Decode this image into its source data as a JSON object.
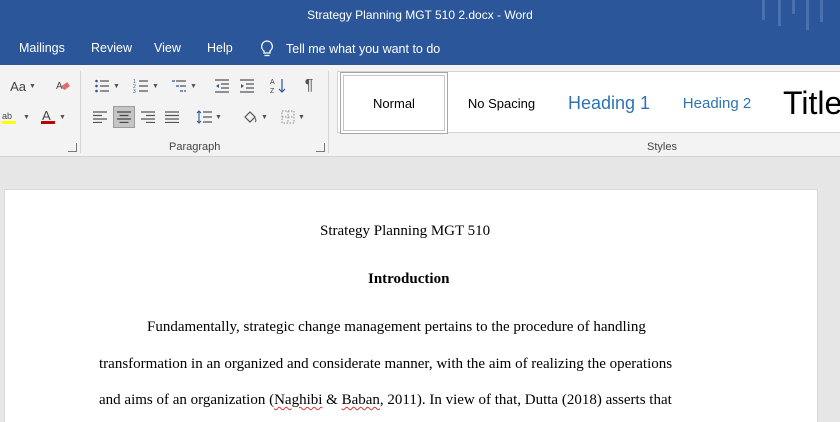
{
  "window": {
    "title": "Strategy Planning MGT 510 2.docx  -  Word"
  },
  "tabs": [
    "Mailings",
    "Review",
    "View",
    "Help"
  ],
  "tell_me": "Tell me what you want to do",
  "ribbon": {
    "font_group": {
      "change_case": "Aa"
    },
    "paragraph_label": "Paragraph",
    "styles_label": "Styles",
    "styles": [
      "Normal",
      "No Spacing",
      "Heading 1",
      "Heading 2",
      "Title"
    ]
  },
  "document": {
    "title_line": "Strategy Planning MGT 510",
    "heading": "Introduction",
    "line1": "Fundamentally, strategic change management pertains to the procedure of handling",
    "line2": "transformation in an organized and considerate manner, with the aim of realizing the operations",
    "line3_a": "and aims of an organization (",
    "line3_b": "Naghibi",
    "line3_c": " & ",
    "line3_d": "Baban",
    "line3_e": ", 2011). In view of that, Dutta (2018) asserts that"
  },
  "colors": {
    "brand": "#2b579a",
    "heading_style": "#2e74b5",
    "font_color_bar": "#c00000",
    "highlight_bar": "#ffff00"
  }
}
